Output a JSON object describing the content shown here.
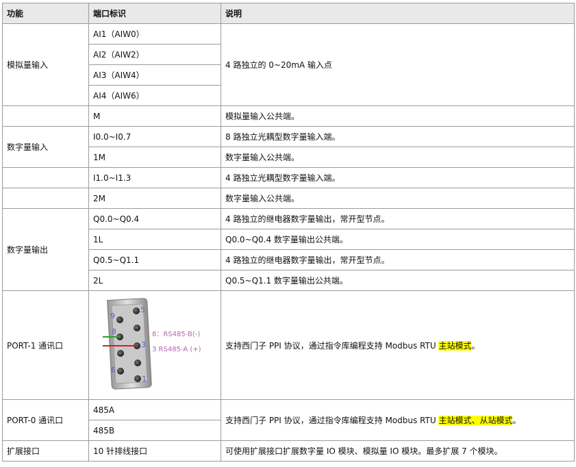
{
  "headers": {
    "func": "功能",
    "port": "端口标识",
    "desc": "说明"
  },
  "analog": {
    "func": "模拟量输入",
    "ports": [
      "AI1（AIW0）",
      "AI2（AIW2）",
      "AI3（AIW4）",
      "AI4（AIW6）"
    ],
    "desc": "4 路独立的 0~20mA 输入点",
    "m_port": "M",
    "m_desc": "模拟量输入公共端。"
  },
  "digital_in": {
    "func": "数字量输入",
    "rows": [
      {
        "port": "I0.0~I0.7",
        "desc": "8 路独立光耦型数字量输入端。"
      },
      {
        "port": "1M",
        "desc": "数字量输入公共端。"
      },
      {
        "port": "I1.0~I1.3",
        "desc": "4 路独立光耦型数字量输入端。"
      },
      {
        "port": "2M",
        "desc": "数字量输入公共端。"
      }
    ]
  },
  "digital_out": {
    "func": "数字量输出",
    "rows": [
      {
        "port": "Q0.0~Q0.4",
        "desc": "4 路独立的继电器数字量输出，常开型节点。"
      },
      {
        "port": "1L",
        "desc": "Q0.0~Q0.4 数字量输出公共端。"
      },
      {
        "port": "Q0.5~Q1.1",
        "desc": "4 路独立的继电器数字量输出，常开型节点。"
      },
      {
        "port": "2L",
        "desc": "Q0.5~Q1.1 数字量输出公共端。"
      }
    ]
  },
  "port1": {
    "func": "PORT-1 通讯口",
    "desc_pre": "支持西门子 PPI 协议，通过指令库编程支持 Modbus RTU ",
    "desc_hl": "主站模式",
    "desc_post": "。",
    "connector": {
      "pins": [
        "1",
        "2",
        "3",
        "4",
        "5",
        "6",
        "7",
        "8",
        "9"
      ],
      "pin8_label": "8：RS485-B(-)",
      "pin3_label": "3  RS485-A (+)",
      "colors": {
        "pin8_wire": "#2aa12a",
        "pin3_wire": "#d42020",
        "pin_number": "#5560c8",
        "label": "#b366b3"
      }
    }
  },
  "port0": {
    "func": "PORT-0 通讯口",
    "ports": [
      "485A",
      "485B"
    ],
    "desc_pre": "支持西门子 PPI 协议，通过指令库编程支持 Modbus RTU ",
    "desc_hl": "主站模式、从站模式",
    "desc_post": "。"
  },
  "expansion": {
    "func": "扩展接口",
    "port": "10 针排线接口",
    "desc": "可使用扩展接口扩展数字量 IO 模块、模拟量 IO 模块。最多扩展 7 个模块。"
  },
  "highlight_color": "#ffff00"
}
